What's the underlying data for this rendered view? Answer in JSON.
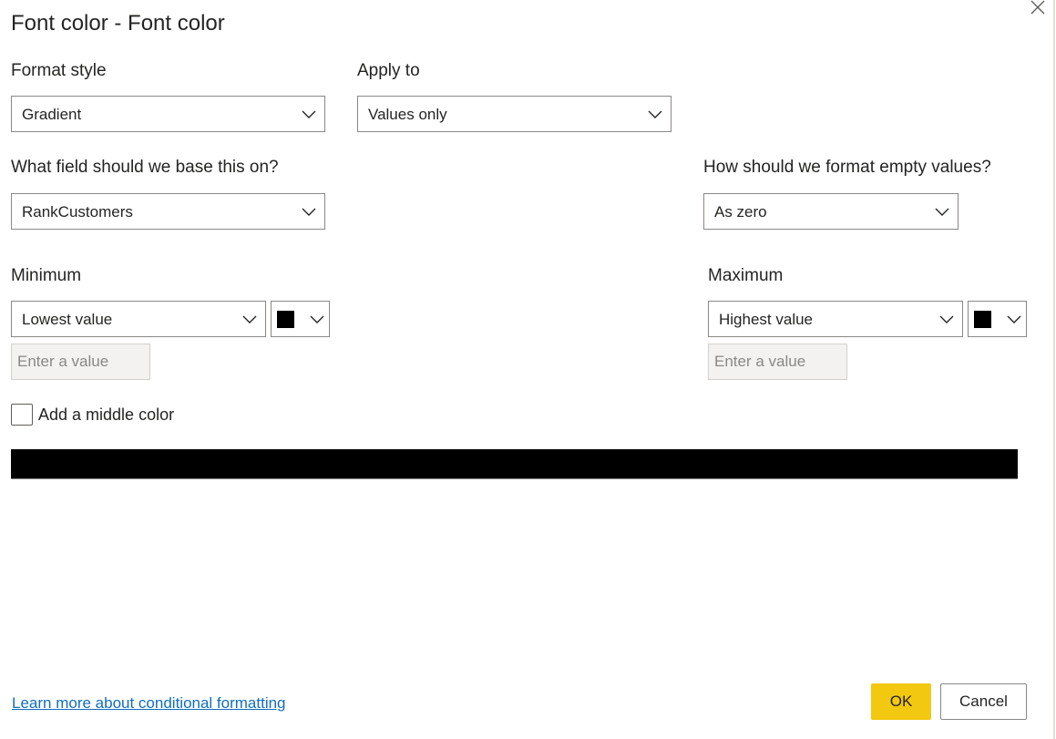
{
  "dialog": {
    "title": "Font color - Font color"
  },
  "format_style": {
    "label": "Format style",
    "value": "Gradient"
  },
  "apply_to": {
    "label": "Apply to",
    "value": "Values only"
  },
  "base_field": {
    "label": "What field should we base this on?",
    "value": "RankCustomers"
  },
  "empty_values": {
    "label": "How should we format empty values?",
    "value": "As zero"
  },
  "minimum": {
    "label": "Minimum",
    "value": "Lowest value",
    "color": "#000000",
    "input_placeholder": "Enter a value"
  },
  "maximum": {
    "label": "Maximum",
    "value": "Highest value",
    "color": "#000000",
    "input_placeholder": "Enter a value"
  },
  "middle_color": {
    "label": "Add a middle color",
    "checked": false
  },
  "gradient": {
    "from": "#000000",
    "to": "#000000"
  },
  "footer": {
    "learn_more": "Learn more about conditional formatting",
    "ok": "OK",
    "cancel": "Cancel"
  },
  "icons": {
    "close": "close-icon",
    "dropdown": "chevron-down-icon"
  },
  "colors": {
    "accent": "#f2c811",
    "link": "#106ebe"
  }
}
